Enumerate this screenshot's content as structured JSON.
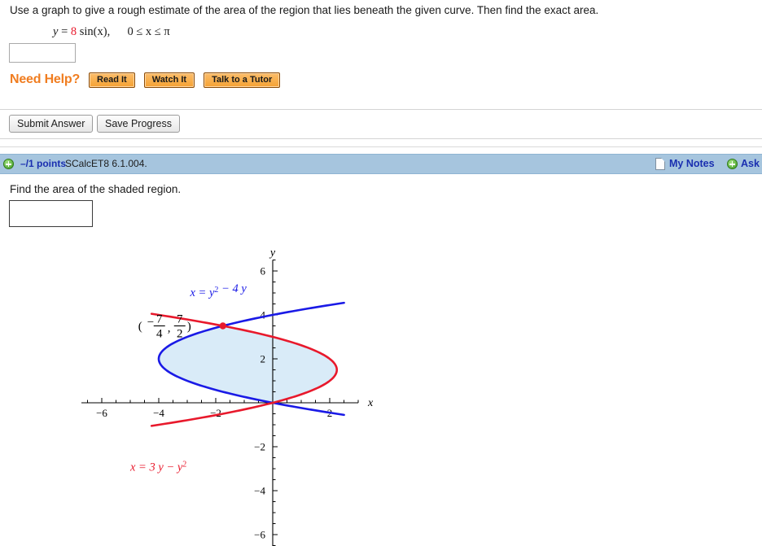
{
  "problem1": {
    "prompt": "Use a graph to give a rough estimate of the area of the region that lies beneath the given curve. Then find the exact area.",
    "equation": {
      "lhs": "y",
      "equals": "=",
      "coefficient": "8",
      "func": "sin(x),",
      "domain": "0 ≤ x ≤ π"
    },
    "answer_value": "",
    "need_help": {
      "label": "Need Help?",
      "buttons": [
        "Read It",
        "Watch It",
        "Talk to a Tutor"
      ]
    }
  },
  "toolbar": {
    "submit_label": "Submit Answer",
    "save_label": "Save Progress"
  },
  "points_bar": {
    "points": "–/1 points",
    "code": "SCalcET8 6.1.004.",
    "my_notes": "My Notes",
    "ask": "Ask",
    "bar_color": "#a6c5de",
    "link_color": "#1a2fb0"
  },
  "problem2": {
    "prompt": "Find the area of the shaded region.",
    "answer_value": ""
  },
  "chart_data": {
    "type": "line",
    "title": "",
    "xlabel": "x",
    "ylabel": "y",
    "xlim": [
      -7,
      3
    ],
    "ylim": [
      -6.6,
      6.5
    ],
    "xticks": [
      -6,
      -4,
      -2,
      2
    ],
    "yticks": [
      6,
      4,
      2,
      -2,
      -4,
      -6
    ],
    "grid": false,
    "series": [
      {
        "name": "x = y² − 4 y",
        "color": "#1a1ae6",
        "label_text": "x = y² − 4 y",
        "label_x": -2.9,
        "label_y": 4.85,
        "equation": "x = y^2 - 4y",
        "param_y_range": [
          -0.55,
          4.55
        ]
      },
      {
        "name": "x = 3 y − y²",
        "color": "#e8192c",
        "label_text": "x = 3 y − y²",
        "label_x": -5.0,
        "label_y": -3.1,
        "equation": "x = 3y - y^2",
        "param_y_range": [
          -1.05,
          4.05
        ]
      }
    ],
    "shaded_region": {
      "fill_color": "#d9ebf8",
      "between": [
        "x = 3 y − y²",
        "x = y² − 4 y"
      ],
      "y_from": 0,
      "y_to": 3.5
    },
    "points": [
      {
        "x": -1.75,
        "y": 3.5,
        "color": "#e8192c",
        "label": "(− 7/4, 7/2)",
        "label_num1": "7",
        "label_den1": "4",
        "label_num2": "7",
        "label_den2": "2"
      }
    ]
  }
}
